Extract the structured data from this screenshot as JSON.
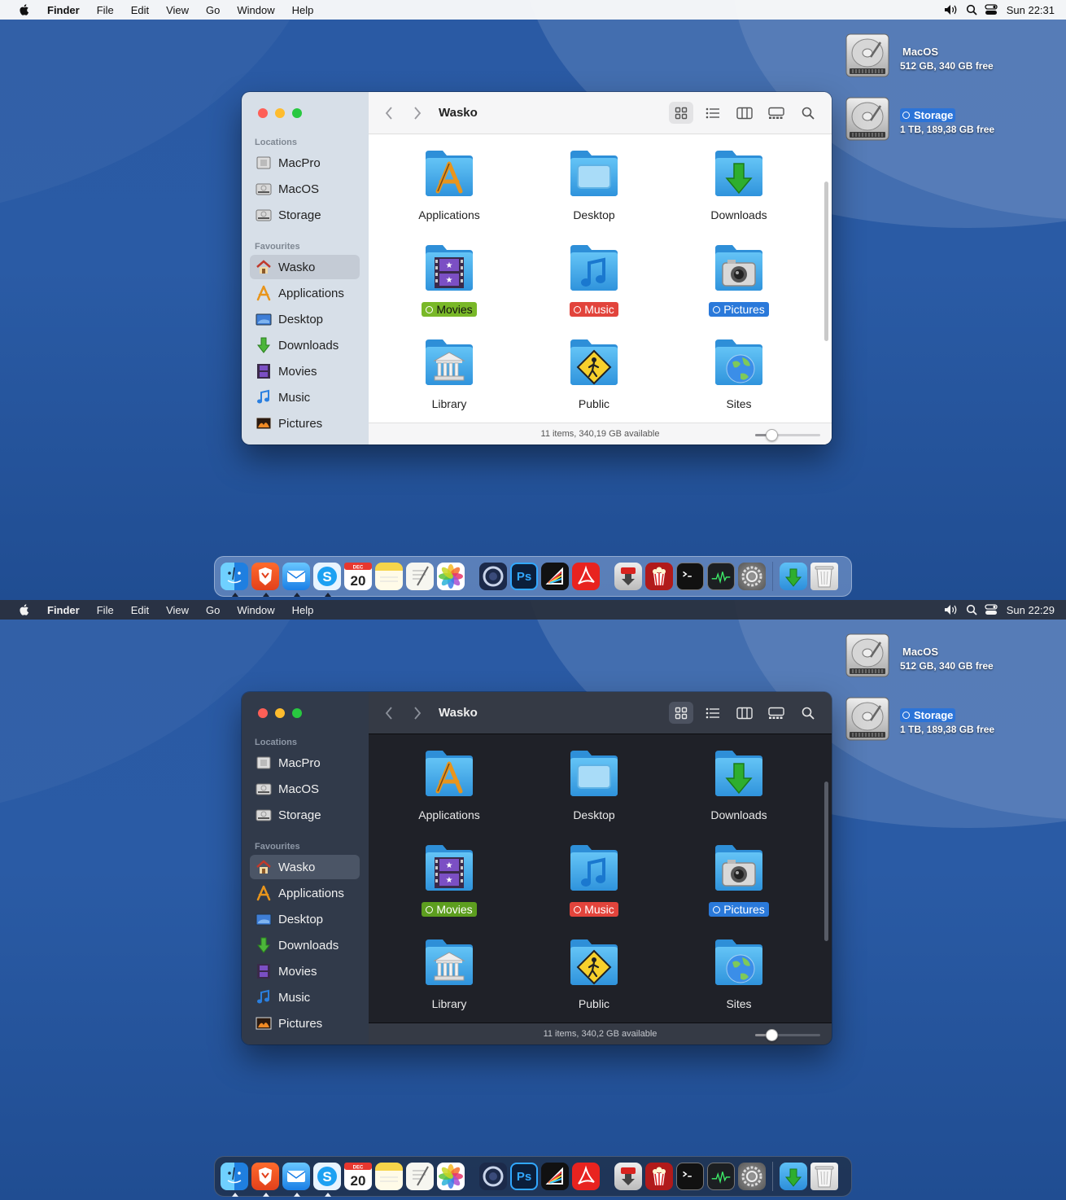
{
  "menubar": {
    "items": [
      "Finder",
      "File",
      "Edit",
      "View",
      "Go",
      "Window",
      "Help"
    ]
  },
  "screens": [
    {
      "theme": "light",
      "clock": "Sun 22:31",
      "status": "11 items, 340,19 GB available"
    },
    {
      "theme": "dark",
      "clock": "Sun 22:29",
      "status": "11 items, 340,2 GB available"
    }
  ],
  "desktop_drives": [
    {
      "name": "MacOS",
      "info": "512 GB, 340 GB free",
      "tag": null
    },
    {
      "name": "Storage",
      "info": "1 TB, 189,38 GB free",
      "tag": "blue"
    }
  ],
  "finder": {
    "title": "Wasko",
    "sidebar": {
      "locations_header": "Locations",
      "locations": [
        {
          "label": "MacPro",
          "icon": "computer-icon"
        },
        {
          "label": "MacOS",
          "icon": "hard-drive-icon"
        },
        {
          "label": "Storage",
          "icon": "hard-drive-icon"
        }
      ],
      "favourites_header": "Favourites",
      "favourites": [
        {
          "label": "Wasko",
          "icon": "home-icon",
          "selected": true
        },
        {
          "label": "Applications",
          "icon": "applications-icon"
        },
        {
          "label": "Desktop",
          "icon": "desktop-icon"
        },
        {
          "label": "Downloads",
          "icon": "downloads-icon"
        },
        {
          "label": "Movies",
          "icon": "movies-icon"
        },
        {
          "label": "Music",
          "icon": "music-icon"
        },
        {
          "label": "Pictures",
          "icon": "pictures-icon"
        }
      ]
    },
    "items": [
      {
        "label": "Applications",
        "icon": "applications-folder-icon",
        "tag": null
      },
      {
        "label": "Desktop",
        "icon": "desktop-folder-icon",
        "tag": null
      },
      {
        "label": "Downloads",
        "icon": "downloads-folder-icon",
        "tag": null
      },
      {
        "label": "Movies",
        "icon": "movies-folder-icon",
        "tag": "green"
      },
      {
        "label": "Music",
        "icon": "music-folder-icon",
        "tag": "red"
      },
      {
        "label": "Pictures",
        "icon": "pictures-folder-icon",
        "tag": "blue"
      },
      {
        "label": "Library",
        "icon": "library-folder-icon",
        "tag": null
      },
      {
        "label": "Public",
        "icon": "public-folder-icon",
        "tag": null
      },
      {
        "label": "Sites",
        "icon": "sites-folder-icon",
        "tag": null
      }
    ],
    "icon_size_level": 0.25
  },
  "dock": {
    "apps": [
      {
        "name": "finder-icon",
        "running": true
      },
      {
        "name": "brave-icon",
        "running": true
      },
      {
        "name": "mail-icon",
        "running": true
      },
      {
        "name": "skype-icon",
        "running": true
      },
      {
        "name": "calendar-icon",
        "running": false,
        "month": "DEC",
        "day": "20"
      },
      {
        "name": "notes-icon",
        "running": false
      },
      {
        "name": "textedit-icon",
        "running": false
      },
      {
        "name": "photos-icon",
        "running": false
      },
      {
        "name": "cinema4d-icon",
        "running": false
      },
      {
        "name": "photoshop-icon",
        "running": false,
        "text": "Ps"
      },
      {
        "name": "prism-icon",
        "running": false
      },
      {
        "name": "acrobat-icon",
        "running": false
      },
      {
        "name": "transmission-icon",
        "running": false
      },
      {
        "name": "popcorn-icon",
        "running": false
      },
      {
        "name": "terminal-icon",
        "running": false
      },
      {
        "name": "activity-monitor-icon",
        "running": false
      },
      {
        "name": "system-preferences-icon",
        "running": false
      }
    ],
    "stacks": [
      "downloads-stack-icon",
      "trash-icon"
    ]
  },
  "colors": {
    "tag_green": "#79b828",
    "tag_red": "#e2443c",
    "tag_blue": "#2a79da",
    "folder_blue": "#3aa7e8"
  }
}
